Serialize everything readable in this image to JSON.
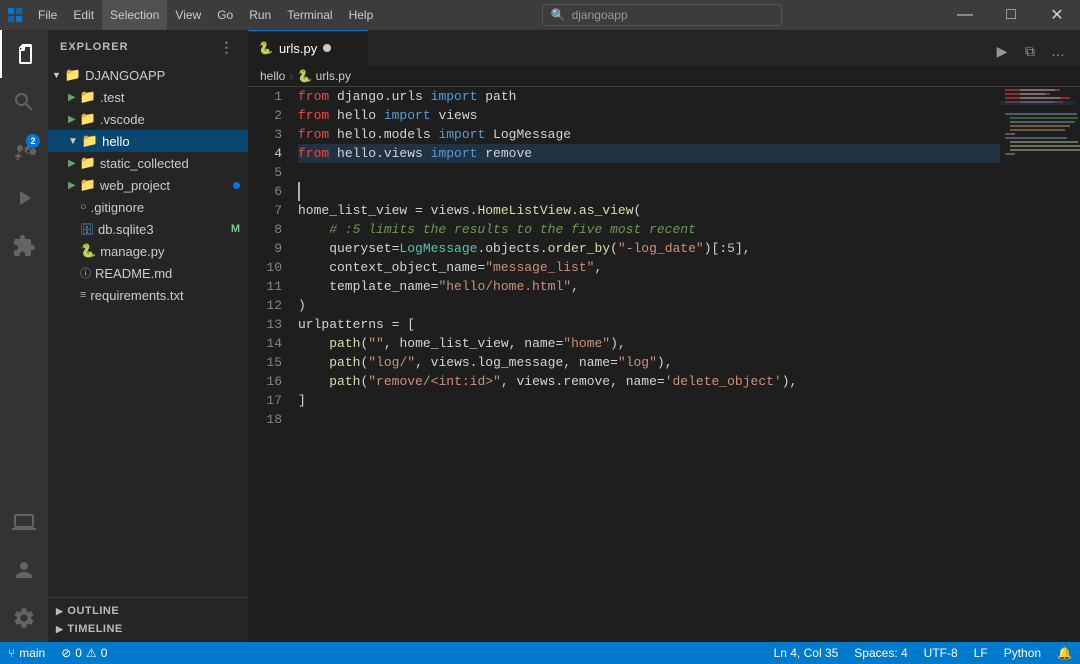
{
  "titlebar": {
    "icon": "◆",
    "menus": [
      "File",
      "Edit",
      "Selection",
      "View",
      "Go",
      "Run",
      "Terminal",
      "Help"
    ],
    "search_placeholder": "djangoapp",
    "active_menu": "Selection"
  },
  "activity_bar": {
    "items": [
      {
        "name": "explorer",
        "icon": "⧉",
        "active": true
      },
      {
        "name": "search",
        "icon": "🔍"
      },
      {
        "name": "source-control",
        "icon": "⑂",
        "badge": "2"
      },
      {
        "name": "run-debug",
        "icon": "▶"
      },
      {
        "name": "extensions",
        "icon": "⊞"
      },
      {
        "name": "remote-explorer",
        "icon": "🖥"
      },
      {
        "name": "accounts",
        "icon": "👤"
      },
      {
        "name": "settings",
        "icon": "⚙"
      }
    ]
  },
  "sidebar": {
    "title": "Explorer",
    "project": "DJANGOAPP",
    "items": [
      {
        "name": ".test",
        "indent": 1,
        "type": "folder",
        "icon": "▶"
      },
      {
        "name": ".vscode",
        "indent": 1,
        "type": "folder",
        "icon": "▶"
      },
      {
        "name": "hello",
        "indent": 1,
        "type": "folder",
        "icon": "▼",
        "active": true
      },
      {
        "name": "static_collected",
        "indent": 1,
        "type": "folder",
        "icon": "▶"
      },
      {
        "name": "web_project",
        "indent": 1,
        "type": "folder",
        "icon": "▶",
        "dot": true
      },
      {
        "name": ".gitignore",
        "indent": 1,
        "type": "file"
      },
      {
        "name": "db.sqlite3",
        "indent": 1,
        "type": "file",
        "badge": "M"
      },
      {
        "name": "manage.py",
        "indent": 1,
        "type": "file"
      },
      {
        "name": "README.md",
        "indent": 1,
        "type": "file"
      },
      {
        "name": "requirements.txt",
        "indent": 1,
        "type": "file"
      }
    ],
    "sections": [
      {
        "name": "OUTLINE"
      },
      {
        "name": "TIMELINE"
      }
    ]
  },
  "editor": {
    "tab": {
      "name": "urls.py",
      "icon": "🐍",
      "modified": true
    },
    "breadcrumbs": [
      "hello",
      "urls.py"
    ],
    "lines": [
      {
        "num": 1,
        "content": "from django.urls import path",
        "tokens": [
          {
            "text": "from",
            "class": "kw-from"
          },
          {
            "text": " django.urls ",
            "class": "plain"
          },
          {
            "text": "import",
            "class": "kw-import"
          },
          {
            "text": " path",
            "class": "plain"
          }
        ]
      },
      {
        "num": 2,
        "content": "from hello import views",
        "tokens": [
          {
            "text": "from",
            "class": "kw-from"
          },
          {
            "text": " hello ",
            "class": "plain"
          },
          {
            "text": "import",
            "class": "kw-import"
          },
          {
            "text": " views",
            "class": "plain"
          }
        ]
      },
      {
        "num": 3,
        "content": "from hello.models import LogMessage",
        "tokens": [
          {
            "text": "from",
            "class": "kw-from"
          },
          {
            "text": " hello.models ",
            "class": "plain"
          },
          {
            "text": "import",
            "class": "kw-import"
          },
          {
            "text": " LogMessage",
            "class": "plain"
          }
        ]
      },
      {
        "num": 4,
        "content": "from hello.views import remove",
        "tokens": [
          {
            "text": "from",
            "class": "kw-from"
          },
          {
            "text": " hello.views ",
            "class": "plain"
          },
          {
            "text": "import",
            "class": "kw-import"
          },
          {
            "text": " remove",
            "class": "plain"
          }
        ],
        "selected": true
      },
      {
        "num": 5,
        "content": ""
      },
      {
        "num": 6,
        "content": ""
      },
      {
        "num": 7,
        "content": "home_list_view = views.HomeListView.as_view("
      },
      {
        "num": 8,
        "content": "    # :5 limits the results to the five most recent",
        "comment": true
      },
      {
        "num": 9,
        "content": "    queryset=LogMessage.objects.order_by(\"-log_date\")[:5],"
      },
      {
        "num": 10,
        "content": "    context_object_name=\"message_list\","
      },
      {
        "num": 11,
        "content": "    template_name=\"hello/home.html\","
      },
      {
        "num": 12,
        "content": ")"
      },
      {
        "num": 13,
        "content": "urlpatterns = ["
      },
      {
        "num": 14,
        "content": "    path(\"\", home_list_view, name=\"home\"),"
      },
      {
        "num": 15,
        "content": "    path(\"log/\", views.log_message, name=\"log\"),"
      },
      {
        "num": 16,
        "content": "    path(\"remove/<int:id>\", views.remove, name='delete_object'),"
      },
      {
        "num": 17,
        "content": "]"
      },
      {
        "num": 18,
        "content": ""
      }
    ]
  },
  "status_bar": {
    "branch": "main",
    "errors": "0",
    "warnings": "0",
    "line_col": "Ln 4, Col 35",
    "spaces": "Spaces: 4",
    "encoding": "UTF-8",
    "line_ending": "LF",
    "language": "Python"
  }
}
